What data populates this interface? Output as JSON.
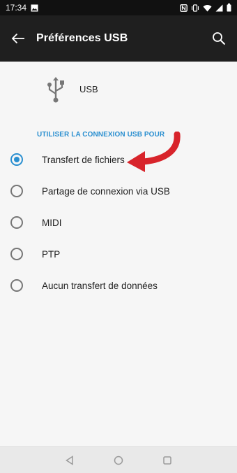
{
  "status_bar": {
    "time": "17:34",
    "icons": [
      "image-icon",
      "nfc-icon",
      "vibrate-icon",
      "wifi-icon",
      "signal-icon",
      "battery-icon"
    ]
  },
  "app_bar": {
    "title": "Préférences USB"
  },
  "usb": {
    "label": "USB"
  },
  "section": {
    "header": "UTILISER LA CONNEXION USB POUR"
  },
  "options": [
    {
      "label": "Transfert de fichiers",
      "checked": true
    },
    {
      "label": "Partage de connexion via USB",
      "checked": false
    },
    {
      "label": "MIDI",
      "checked": false
    },
    {
      "label": "PTP",
      "checked": false
    },
    {
      "label": "Aucun transfert de données",
      "checked": false
    }
  ],
  "colors": {
    "accent": "#2a8fd0",
    "annotation_arrow": "#d8242b",
    "app_bar": "#1f1f1f"
  }
}
